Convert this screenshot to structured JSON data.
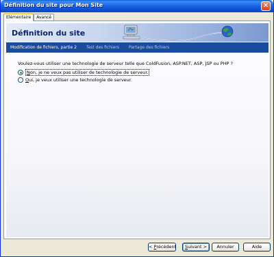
{
  "window": {
    "title": "Définition du site pour Mon Site",
    "close_glyph": "✕"
  },
  "tabs": [
    {
      "label": "Elémentaire",
      "active": true
    },
    {
      "label": "Avancé",
      "active": false
    }
  ],
  "banner": {
    "title": "Définition du site",
    "art_icons": [
      "computer-icon",
      "globe-icon"
    ]
  },
  "steps": [
    {
      "label": "Modification de fichiers, partie 2",
      "current": true
    },
    {
      "label": "Test des fichiers",
      "current": false
    },
    {
      "label": "Partage des fichiers",
      "current": false
    }
  ],
  "question": "Voulez-vous utiliser une technologie de serveur telle que ColdFusion, ASP.NET, ASP, JSP ou PHP ?",
  "options": [
    {
      "mnemonic": "N",
      "rest": "on, je ne veux pas utiliser de technologie de serveur.",
      "checked": true
    },
    {
      "mnemonic": "O",
      "rest": "ui, je veux utiliser une technologie de serveur.",
      "checked": false
    }
  ],
  "buttons": {
    "prev": {
      "prefix": "< ",
      "mnemonic": "P",
      "rest": "récédent"
    },
    "next": {
      "mnemonic": "S",
      "rest": "uivant >"
    },
    "cancel": "Annuler",
    "help": "Aide"
  },
  "colors": {
    "title_bar": "#0a4fd0",
    "steps_bar": "#1b4b9c",
    "banner_title": "#0a246a",
    "radio_dot": "#21a121"
  }
}
